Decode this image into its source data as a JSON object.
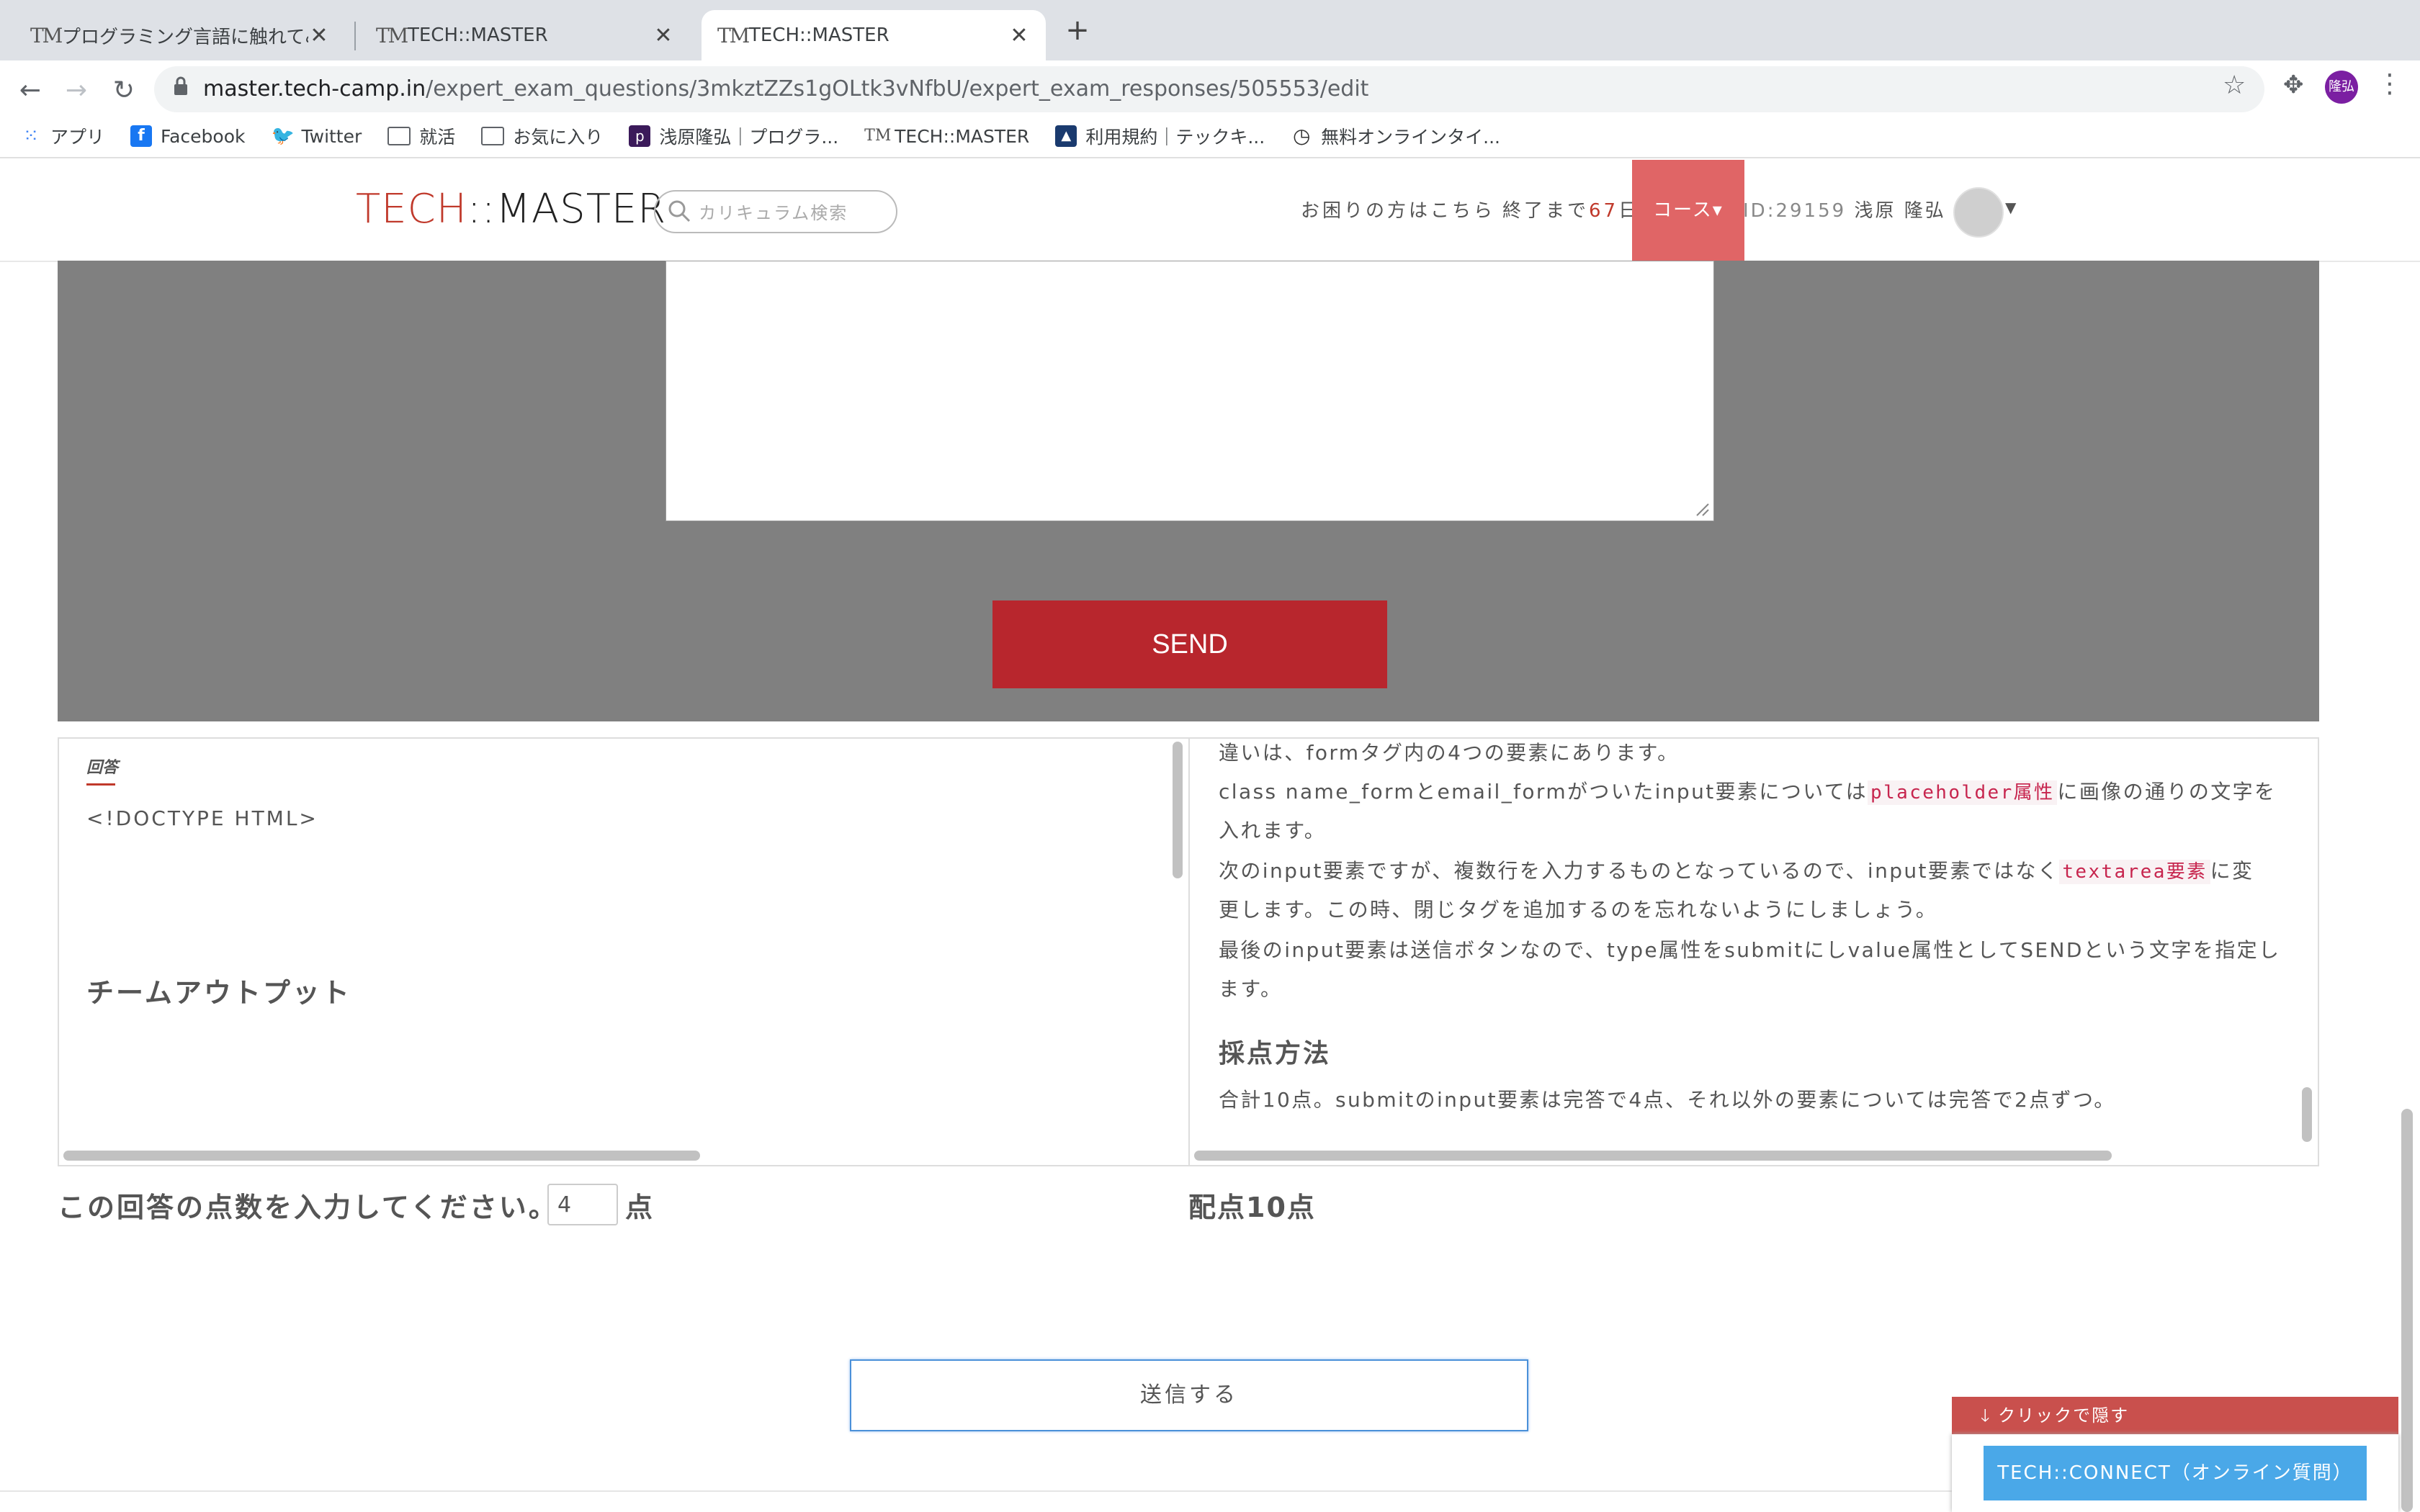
{
  "browser": {
    "tabs": [
      {
        "favicon": "TM",
        "title": "プログラミング言語に触れてみよう"
      },
      {
        "favicon": "TM",
        "title": "TECH::MASTER"
      },
      {
        "favicon": "TM",
        "title": "TECH::MASTER"
      }
    ],
    "url_host": "master.tech-camp.in",
    "url_path": "/expert_exam_questions/3mkztZZs1gOLtk3vNfbU/expert_exam_responses/505553/edit",
    "profile_label": "隆弘",
    "bookmarks": [
      {
        "icon": "apps-grid-icon",
        "label": "アプリ"
      },
      {
        "icon": "facebook-icon",
        "label": "Facebook"
      },
      {
        "icon": "twitter-icon",
        "label": "Twitter"
      },
      {
        "icon": "folder-icon",
        "label": "就活"
      },
      {
        "icon": "folder-icon",
        "label": "お気に入り"
      },
      {
        "icon": "p-icon",
        "label": "浅原隆弘｜プログラ..."
      },
      {
        "icon": "tm-icon",
        "label": "TECH::MASTER"
      },
      {
        "icon": "triangle-icon",
        "label": "利用規約｜テックキ..."
      },
      {
        "icon": "clock-icon",
        "label": "無料オンラインタイ..."
      }
    ]
  },
  "header": {
    "logo_tech": "TECH",
    "logo_rest": "::MASTER",
    "search_placeholder": "カリキュラム検索",
    "help_link": "お困りの方はこちら",
    "remain_prefix": "終了まで",
    "remain_days": "67",
    "remain_suffix": "日",
    "course_label": "コース▾",
    "user_id": "ID:29159",
    "user_name": "浅原 隆弘"
  },
  "preview": {
    "send_label": "SEND"
  },
  "answer": {
    "label": "回答",
    "doctype": "<!DOCTYPE HTML>",
    "team_output": "チームアウトプット"
  },
  "explanation": {
    "line1": "違いは、formタグ内の4つの要素にあります。",
    "line2_pre": "class name_formとemail_formがついたinput要素については",
    "line2_code": "placeholder属性",
    "line2_post": "に画像の通りの文字を",
    "line3": "入れます。",
    "line4_pre": "次のinput要素ですが、複数行を入力するものとなっているので、input要素ではなく",
    "line4_code": "textarea要素",
    "line4_post": "に変",
    "line5": "更します。この時、閉じタグを追加するのを忘れないようにしましょう。",
    "line6": "最後のinput要素は送信ボタンなので、type属性をsubmitにしvalue属性としてSENDという文字を指定し",
    "line7": "ます。",
    "scoring_heading": "採点方法",
    "scoring_text": "合計10点。submitのinput要素は完答で4点、それ以外の要素については完答で2点ずつ。"
  },
  "score": {
    "prompt": "この回答の点数を入力してください。",
    "value": "4",
    "unit": "点",
    "max_points": "配点10点"
  },
  "submit_label": "送信する",
  "connect_widget": {
    "hide_label": "クリックで隠す",
    "button_label": "TECH::CONNECT（オンライン質問）"
  },
  "colors": {
    "brand_red": "#b8262d",
    "course_tab": "#e06566",
    "preview_gray": "#808080",
    "connect_blue": "#4aa8e8"
  }
}
